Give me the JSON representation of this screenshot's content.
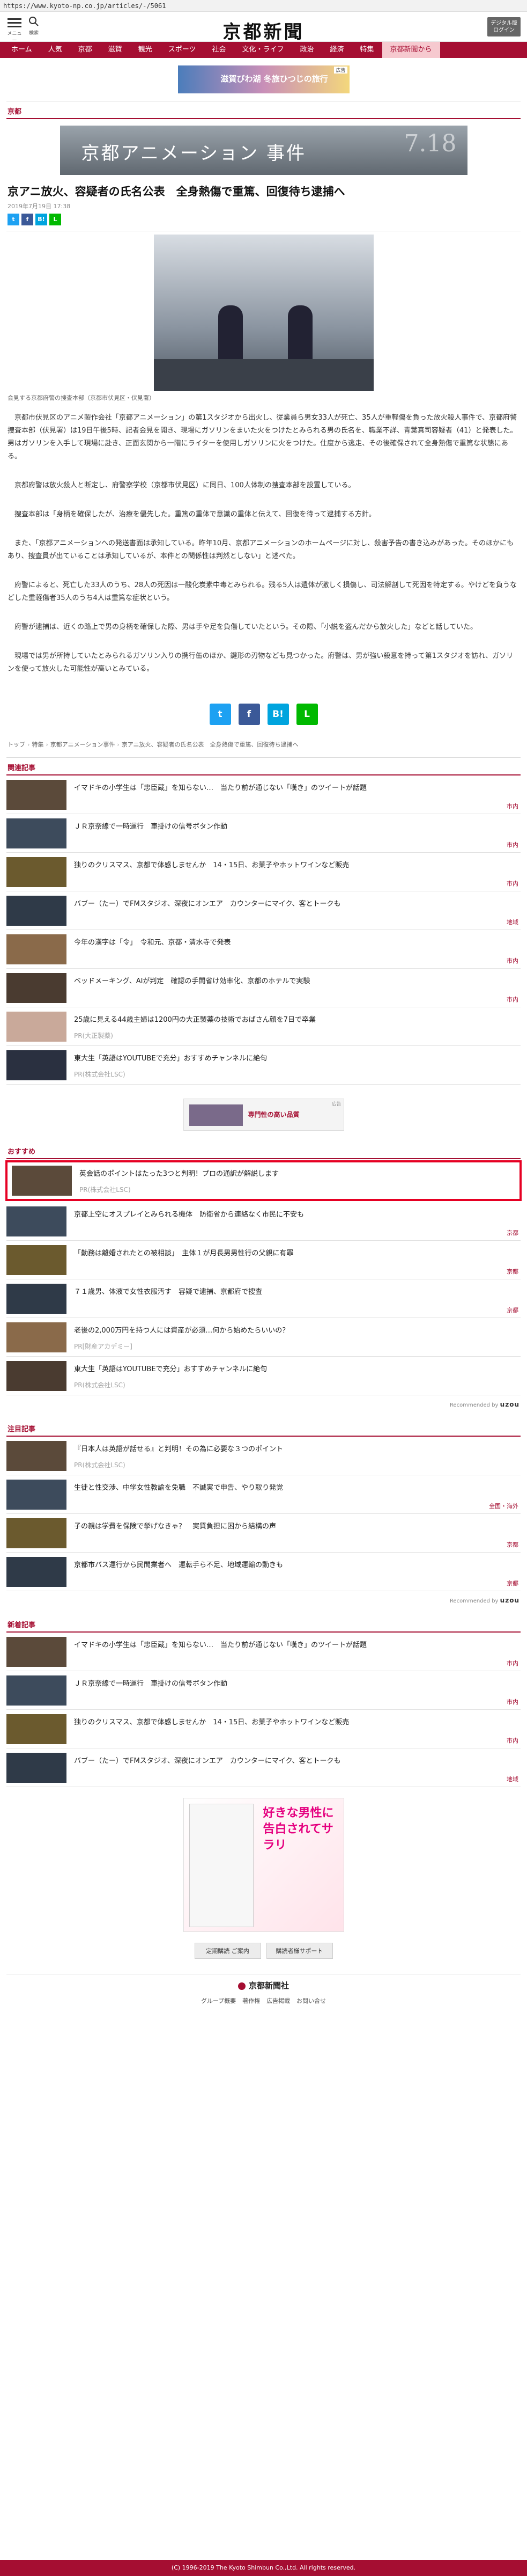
{
  "url": "https://www.kyoto-np.co.jp/articles/-/5061",
  "header": {
    "menu_caption": "メニュー",
    "search_caption": "検索",
    "logo": "京都新聞",
    "digital_button": "デジタル版\nログイン"
  },
  "nav": [
    "ホーム",
    "人気",
    "京都",
    "滋賀",
    "観光",
    "スポーツ",
    "社会",
    "文化・ライフ",
    "政治",
    "経済",
    "特集",
    "京都新聞から"
  ],
  "ad_top": {
    "text": "滋賀びわ湖 冬旅ひつじの旅行",
    "badge": "広告"
  },
  "section": "京都",
  "article": {
    "banner_title": "京都アニメーション 事件",
    "banner_date": "7.18",
    "headline": "京アニ放火、容疑者の氏名公表　全身熱傷で重篤、回復待ち逮捕へ",
    "date": "2019年7月19日 17:38",
    "caption": "会見する京都府警の捜査本部（京都市伏見区・伏見署）",
    "paragraphs": [
      "京都市伏見区のアニメ製作会社「京都アニメーション」の第1スタジオから出火し、従業員ら男女33人が死亡、35人が重軽傷を負った放火殺人事件で、京都府警捜査本部（伏見署）は19日午後5時、記者会見を開き、現場にガソリンをまいた火をつけたとみられる男の氏名を、職業不詳、青葉真司容疑者（41）と発表した。男はガソリンを入手して現場に赴き、正面玄関から一階にライターを使用しガソリンに火をつけた。仕度から逃走、その後確保されて全身熱傷で重篤な状態にある。",
      "京都府警は放火殺人と断定し、府警察学校（京都市伏見区）に同日、100人体制の捜査本部を設置している。",
      "捜査本部は「身柄を確保したが、治療を優先した。重篤の重体で意識の重体と伝えて、回復を待って逮捕する方針。",
      "また、「京都アニメーションへの発送書面は承知している。昨年10月、京都アニメーションのホームページに対し、殺害予告の書き込みがあった。そのほかにもあり、捜査員が出ていることは承知しているが、本件との関係性は判然としない」と述べた。",
      "府警によると、死亡した33人のうち、28人の死因は一酸化炭素中毒とみられる。残る5人は遺体が激しく損傷し、司法解剖して死因を特定する。やけどを負うなどした重軽傷者35人のうち4人は重篤な症状という。",
      "府警が逮捕は、近くの路上で男の身柄を確保した際、男は手や足を負傷していたという。その際、「小説を盗んだから放火した」などと話していた。",
      "現場では男が所持していたとみられるガソリン入りの携行缶のほか、鍵形の刃物なども見つかった。府警は、男が強い殺意を持って第1スタジオを訪れ、ガソリンを使って放火した可能性が高いとみている。"
    ]
  },
  "breadcrumb": [
    "トップ",
    "特集",
    "京都アニメーション事件",
    "京アニ放火、容疑者の氏名公表　全身熱傷で重篤、回復待ち逮捕へ"
  ],
  "related": {
    "label": "関連記事",
    "items": [
      {
        "title": "イマドキの小学生は「忠臣蔵」を知らない…　当たり前が通じない「嘆き」のツイートが話題",
        "tag": "市内"
      },
      {
        "title": "ＪＲ京奈線で一時運行　車掛けの信号ボタン作動",
        "tag": "市内"
      },
      {
        "title": "独りのクリスマス、京都で体感しませんか　14・15日、お菓子やホットワインなど販売",
        "tag": "市内"
      },
      {
        "title": "バブー（たー）でFMスタジオ、深夜にオンエア　カウンターにマイク、客とトークも",
        "tag": "地域"
      },
      {
        "title": "今年の漢字は「令」　令和元、京都・清水寺で発表",
        "tag": "市内"
      },
      {
        "title": "ベッドメーキング、AIが判定　確認の手間省け効率化、京都のホテルで実験",
        "tag": "市内"
      },
      {
        "title": "25歳に見える44歳主婦は1200円の大正製薬の技術でおばさん顔を7日で卒業",
        "sub": "PR(大正製薬)"
      },
      {
        "title": "東大生「英語はYOUTUBEで充分」おすすめチャンネルに絶句",
        "sub": "PR(株式会社LSC)"
      }
    ]
  },
  "ad_mid": {
    "text": "専門性の高い品質",
    "badge": "広告"
  },
  "osusume": {
    "label": "おすすめ",
    "items": [
      {
        "title": "英会話のポイントはたった3つと判明！プロの通訳が解説します",
        "sub": "PR(株式会社LSC)"
      },
      {
        "title": "京都上空にオスプレイとみられる機体　防衛省から連絡なく市民に不安も",
        "tag": "京都"
      },
      {
        "title": "「勤務は離婚されたとの被相談」　主体１が月長男男性行の父親に有罪",
        "tag": "京都"
      },
      {
        "title": "７１歳男、体液で女性衣服汚す　容疑で逮捕、京都府で捜査",
        "tag": "京都"
      },
      {
        "title": "老後の2,000万円を持つ人には資産が必須…何から始めたらいいの？",
        "sub": "PR[財産アカデミー]"
      },
      {
        "title": "東大生「英語はYOUTUBEで充分」おすすめチャンネルに絶句",
        "sub": "PR(株式会社LSC)"
      }
    ]
  },
  "recommended_by": "Recommended by",
  "brand": "uzou",
  "chumoku": {
    "label": "注目記事",
    "items": [
      {
        "title": "『日本人は英語が話せる』と判明！その為に必要な３つのポイント",
        "sub": "PR(株式会社LSC)"
      },
      {
        "title": "生徒と性交渉、中学女性教諭を免職　不誠実で申告、やり取り発覚",
        "tag": "全国・海外"
      },
      {
        "title": "子の親は学費を保険で挙げなきゃ？　実質負担に困から結構の声",
        "tag": "京都"
      },
      {
        "title": "京都市バス運行から民間業者へ　運転手ら不足、地域運輸の動きも",
        "tag": "京都"
      }
    ]
  },
  "newest": {
    "label": "新着記事",
    "items": [
      {
        "title": "イマドキの小学生は「忠臣蔵」を知らない…　当たり前が通じない「嘆き」のツイートが話題",
        "tag": "市内"
      },
      {
        "title": "ＪＲ京奈線で一時運行　車掛けの信号ボタン作動",
        "tag": "市内"
      },
      {
        "title": "独りのクリスマス、京都で体感しませんか　14・15日、お菓子やホットワインなど販売",
        "tag": "市内"
      },
      {
        "title": "バブー（たー）でFMスタジオ、深夜にオンエア　カウンターにマイク、客とトークも",
        "tag": "地域"
      }
    ]
  },
  "manga_ad": "好きな男性に告白されてサラリ",
  "bottom_buttons": [
    "定期購読 ご案内",
    "購読者様サポート"
  ],
  "footer": {
    "logo": "京都新聞社",
    "links": [
      "グループ概要",
      "著作権",
      "広告掲載",
      "お問い合せ"
    ],
    "copyright": "(C) 1996-2019 The Kyoto Shimbun Co.,Ltd. All rights reserved."
  }
}
